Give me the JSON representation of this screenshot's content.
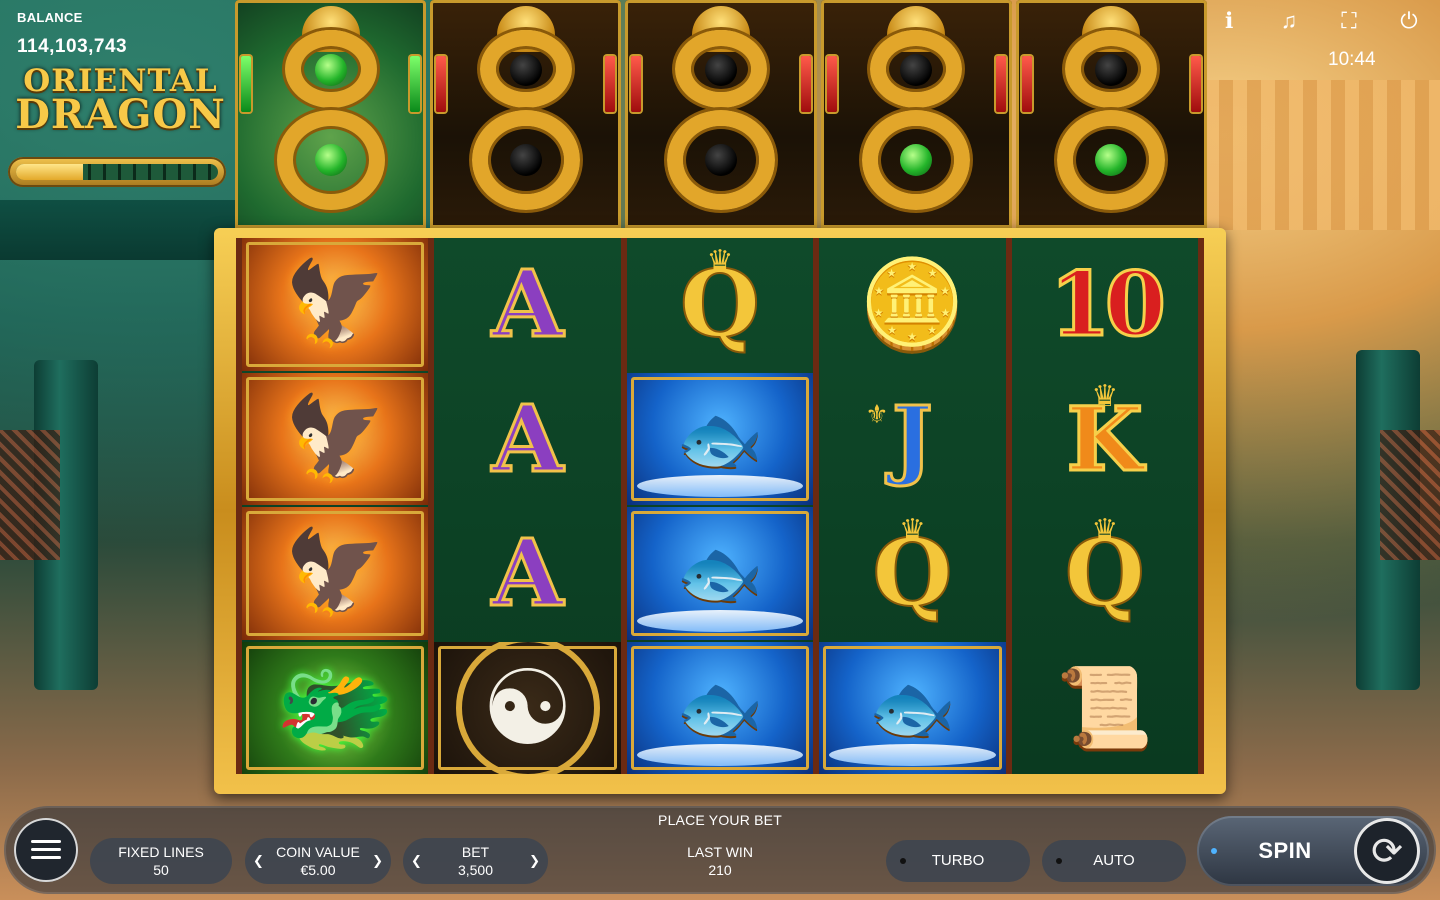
{
  "header": {
    "balance_label": "BALANCE",
    "balance_value": "114,103,743",
    "logo_line1": "ORIENTAL",
    "logo_line2": "DRAGON",
    "progress_fraction": 0.33,
    "clock": "10:44",
    "icons": [
      "info-icon",
      "sound-icon",
      "fullscreen-icon",
      "power-icon"
    ]
  },
  "dragons": [
    {
      "orbs": [
        "green",
        "green"
      ],
      "active": true
    },
    {
      "orbs": [
        "black",
        "black"
      ],
      "active": false
    },
    {
      "orbs": [
        "black",
        "black"
      ],
      "active": false
    },
    {
      "orbs": [
        "black",
        "green"
      ],
      "active": false
    },
    {
      "orbs": [
        "black",
        "green"
      ],
      "active": false
    }
  ],
  "reels": [
    [
      "phoenix",
      "phoenix",
      "phoenix",
      "dragon-wild"
    ],
    [
      "A",
      "A",
      "A",
      "yin-yang"
    ],
    [
      "Q",
      "koi-fish",
      "koi-fish",
      "koi-fish"
    ],
    [
      "gold-coins",
      "J",
      "Q",
      "koi-fish"
    ],
    [
      "10",
      "K",
      "Q",
      "scroll"
    ]
  ],
  "bottom": {
    "status": "PLACE YOUR BET",
    "fixed_lines_label": "FIXED LINES",
    "fixed_lines_value": "50",
    "coin_value_label": "COIN VALUE",
    "coin_value_value": "€5.00",
    "bet_label": "BET",
    "bet_value": "3,500",
    "last_win_label": "LAST WIN",
    "last_win_value": "210",
    "turbo_label": "TURBO",
    "auto_label": "AUTO",
    "spin_label": "SPIN"
  }
}
